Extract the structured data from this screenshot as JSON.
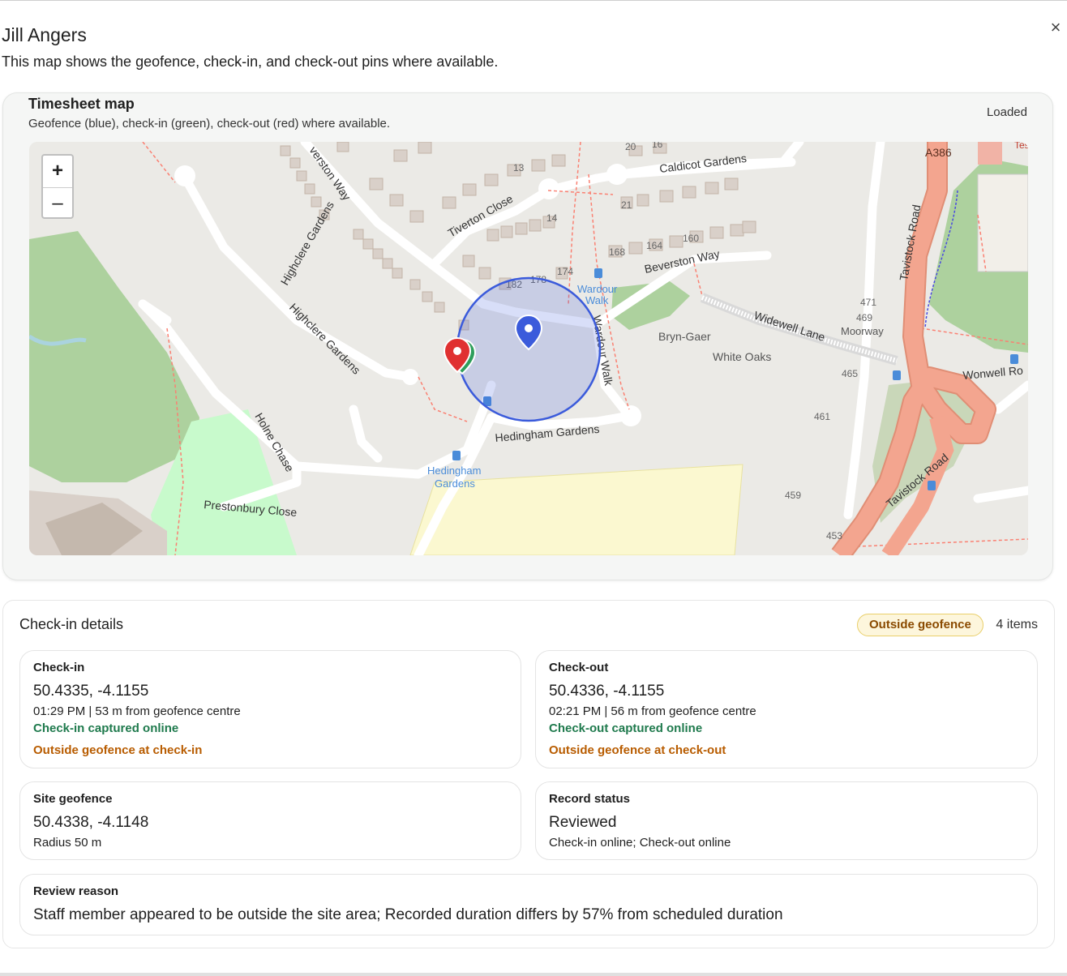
{
  "dialog": {
    "title": "Jill Angers",
    "subtitle": "This map shows the geofence, check-in, and check-out pins where available.",
    "close_icon": "×"
  },
  "map_card": {
    "title": "Timesheet map",
    "subtitle": "Geofence (blue), check-in (green), check-out (red) where available.",
    "status": "Loaded",
    "zoom_in": "+",
    "zoom_out": "–",
    "labels": {
      "caldicot": "Caldicot Gardens",
      "tiverton": "Tiverton Close",
      "beverston_top": "verston Way",
      "beverston": "Beverston Way",
      "highclere1": "Highclere Gardens",
      "highclere2": "Highclere Gardens",
      "wardour1": "Wardour",
      "wardour2": "Walk",
      "wardour_walk": "Wardour Walk",
      "widewell": "Widewell Lane",
      "bryn": "Bryn-Gaer",
      "white_oaks": "White Oaks",
      "moorway": "Moorway",
      "wonwell": "Wonwell Ro",
      "tavistock1": "Tavistock Road",
      "tavistock2": "Tavistock Road",
      "hedingham": "Hedingham Gardens",
      "hedingham_stop1": "Hedingham",
      "hedingham_stop2": "Gardens",
      "holne": "Holne Chase",
      "prestonbury": "Prestonbury Close",
      "a386": "A386",
      "tesco": "Tesc",
      "n20": "20",
      "n16": "16",
      "n13": "13",
      "n14": "14",
      "n21": "21",
      "n168": "168",
      "n164": "164",
      "n160": "160",
      "n174": "174",
      "n182": "182",
      "n178": "178",
      "n471": "471",
      "n469": "469",
      "n465": "465",
      "n461": "461",
      "n459": "459",
      "n453": "453"
    }
  },
  "details": {
    "title": "Check-in details",
    "badge": "Outside geofence",
    "count": "4 items",
    "checkin": {
      "label": "Check-in",
      "coords": "50.4335, -4.1155",
      "meta": "01:29 PM | 53 m from geofence centre",
      "online": "Check-in captured online",
      "warning": "Outside geofence at check-in"
    },
    "checkout": {
      "label": "Check-out",
      "coords": "50.4336, -4.1155",
      "meta": "02:21 PM | 56 m from geofence centre",
      "online": "Check-out captured online",
      "warning": "Outside geofence at check-out"
    },
    "geofence": {
      "label": "Site geofence",
      "coords": "50.4338, -4.1148",
      "radius": "Radius 50 m"
    },
    "record": {
      "label": "Record status",
      "status": "Reviewed",
      "meta": "Check-in online; Check-out online"
    },
    "review": {
      "label": "Review reason",
      "text": "Staff member appeared to be outside the site area; Recorded duration differs by 57% from scheduled duration"
    }
  },
  "colors": {
    "geofence": "#3b5bdb",
    "checkin_pin": "#2e9e5b",
    "checkout_pin": "#e03131",
    "warning": "#b85c00",
    "ok": "#1f7a4d",
    "road_major": "#f2a58c"
  }
}
